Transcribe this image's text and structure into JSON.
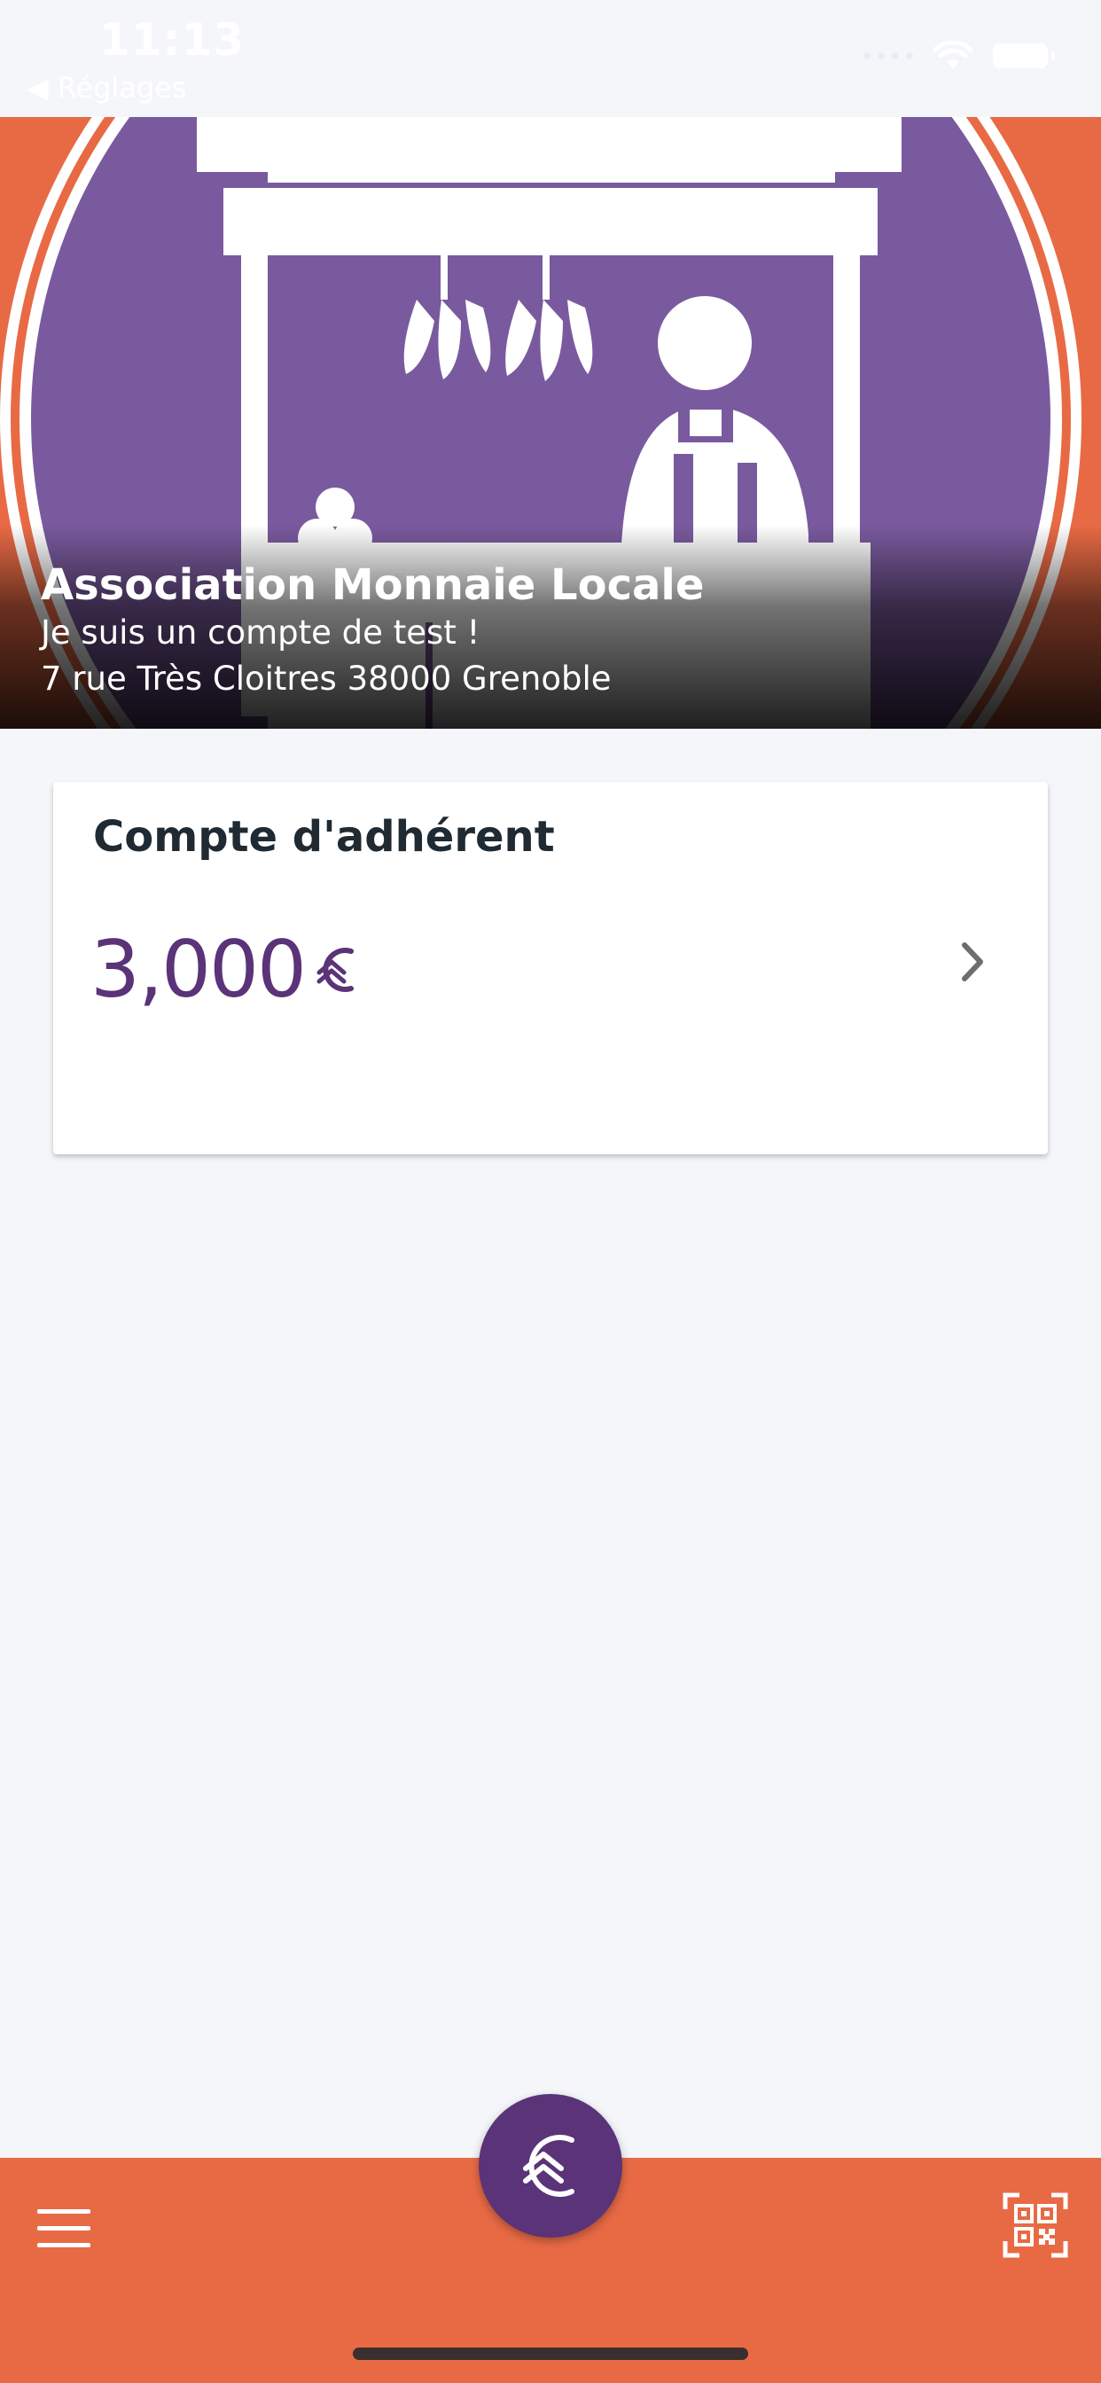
{
  "status_bar": {
    "time": "11:13",
    "back_label": "Réglages"
  },
  "hero": {
    "title": "Association Monnaie Locale",
    "subtitle": "Je suis un compte de test !",
    "address": "7 rue Très Cloitres 38000 Grenoble"
  },
  "account_card": {
    "title": "Compte d'adhérent",
    "amount": "3,000",
    "currency_icon": "local-currency-icon",
    "chevron_icon": "chevron-right-icon"
  },
  "bottom_bar": {
    "menu_icon": "hamburger-menu-icon",
    "fab_icon": "local-currency-icon",
    "qr_icon": "qr-code-scan-icon"
  },
  "colors": {
    "accent_orange": "#e86a45",
    "brand_purple": "#5a3378",
    "hero_purple": "#7a5a9e",
    "background": "#f4f6fa",
    "card_title": "#1f2a33"
  }
}
